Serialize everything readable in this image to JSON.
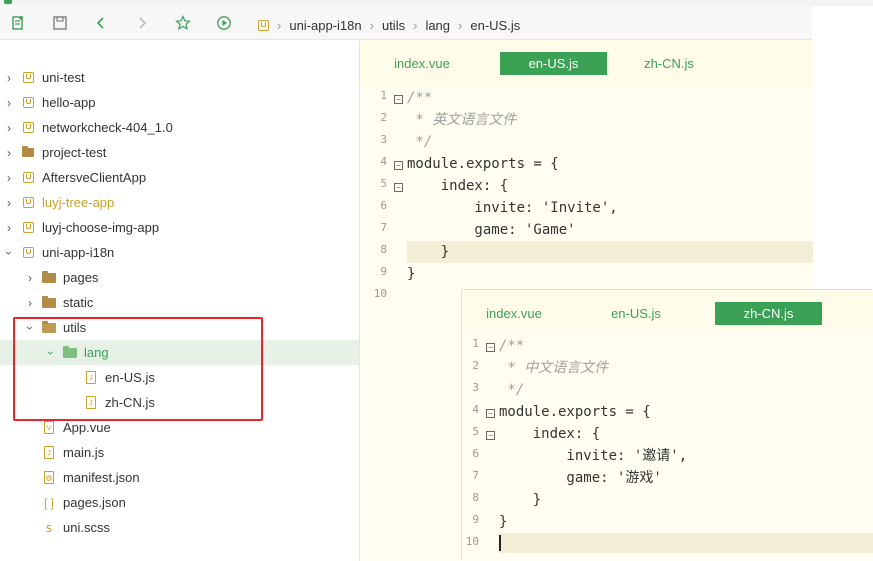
{
  "toolbar": {
    "icons": [
      "new-file-icon",
      "save-icon",
      "back-icon",
      "forward-icon",
      "star-icon",
      "run-icon"
    ],
    "breadcrumb": [
      "uni-app-i18n",
      "utils",
      "lang",
      "en-US.js"
    ]
  },
  "sidebar": {
    "items": [
      {
        "label": "uni-test",
        "kind": "project"
      },
      {
        "label": "hello-app",
        "kind": "project"
      },
      {
        "label": "networkcheck-404_1.0",
        "kind": "project"
      },
      {
        "label": "project-test",
        "kind": "folder-project"
      },
      {
        "label": "AftersveClientApp",
        "kind": "project"
      },
      {
        "label": "luyj-tree-app",
        "kind": "project"
      },
      {
        "label": "luyj-choose-img-app",
        "kind": "project"
      },
      {
        "label": "uni-app-i18n",
        "kind": "project"
      },
      {
        "label": "pages",
        "kind": "folder"
      },
      {
        "label": "static",
        "kind": "folder"
      },
      {
        "label": "utils",
        "kind": "folder"
      },
      {
        "label": "lang",
        "kind": "folder"
      },
      {
        "label": "en-US.js",
        "kind": "js"
      },
      {
        "label": "zh-CN.js",
        "kind": "js"
      },
      {
        "label": "App.vue",
        "kind": "vue"
      },
      {
        "label": "main.js",
        "kind": "js"
      },
      {
        "label": "manifest.json",
        "kind": "manifest"
      },
      {
        "label": "pages.json",
        "kind": "json"
      },
      {
        "label": "uni.scss",
        "kind": "scss"
      }
    ]
  },
  "editor1": {
    "tabs": [
      "index.vue",
      "en-US.js",
      "zh-CN.js"
    ],
    "active_tab": "en-US.js",
    "line_numbers": [
      "1",
      "2",
      "3",
      "4",
      "5",
      "6",
      "7",
      "8",
      "9",
      "10"
    ],
    "lines": [
      "/**",
      " * 英文语言文件",
      " */",
      "module.exports = {",
      "    index: {",
      "        invite: 'Invite',",
      "        game: 'Game'",
      "    }",
      "}",
      ""
    ]
  },
  "editor2": {
    "tabs": [
      "index.vue",
      "en-US.js",
      "zh-CN.js"
    ],
    "active_tab": "zh-CN.js",
    "line_numbers": [
      "1",
      "2",
      "3",
      "4",
      "5",
      "6",
      "7",
      "8",
      "9",
      "10"
    ],
    "lines": [
      "/**",
      " * 中文语言文件",
      " */",
      "module.exports = {",
      "    index: {",
      "        invite: '邀请',",
      "        game: '游戏'",
      "    }",
      "}",
      ""
    ]
  },
  "colors": {
    "accent": "#3aa155",
    "highlight_box": "#e8262b",
    "editor_bg": "#fffef0"
  }
}
